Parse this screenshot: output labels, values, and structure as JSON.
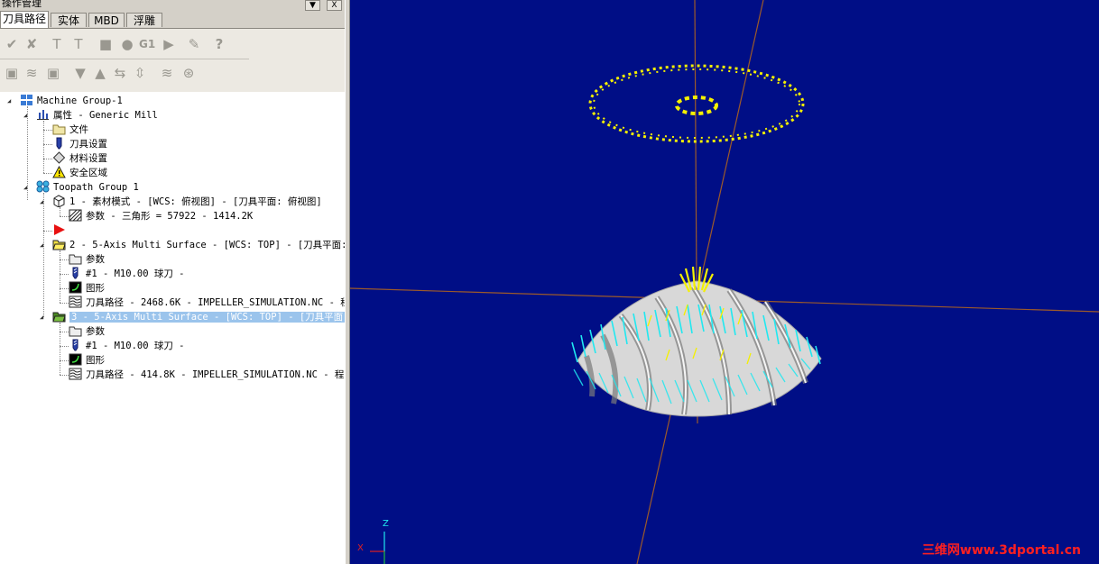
{
  "panel": {
    "title": "操作管理",
    "title_buttons": [
      "▼",
      "X"
    ]
  },
  "tabs": [
    {
      "label": "刀具路径",
      "active": true
    },
    {
      "label": "实体",
      "active": false
    },
    {
      "label": "MBD",
      "active": false
    },
    {
      "label": "浮雕",
      "active": false
    }
  ],
  "toolbar": {
    "row1_icons": [
      "select-all-icon",
      "select-invalid-icon",
      "regenerate-all-icon",
      "regenerate-dirty-icon",
      "stop-icon",
      "verify-icon",
      "simulate-backplot-icon",
      "post-icon",
      "high-feed-icon",
      "help-icon"
    ],
    "row1_g1_label": "G1",
    "row1_question_label": "?",
    "row2_icons": [
      "lock-icon",
      "toggle-display-icon",
      "lock-post-icon",
      "move-down-icon",
      "move-up-icon",
      "insert-arrow-icon",
      "scroll-icon",
      "single-display-icon",
      "toggle-display-group-icon"
    ]
  },
  "tree": [
    {
      "icon": "machine-group-icon",
      "label": "Machine Group-1",
      "expanded": true
    },
    {
      "icon": "properties-icon",
      "label": "属性 - Generic Mill",
      "expanded": true
    },
    {
      "icon": "folder-icon",
      "label": "文件"
    },
    {
      "icon": "tool-settings-icon",
      "label": "刀具设置"
    },
    {
      "icon": "material-settings-icon",
      "label": "材料设置"
    },
    {
      "icon": "warning-icon",
      "label": "安全区域"
    },
    {
      "icon": "toolpath-group-icon",
      "label": "Toopath Group 1",
      "expanded": true
    },
    {
      "icon": "stock-model-icon",
      "label": "1 - 素材模式 - [WCS: 俯视图] - [刀具平面: 俯视图]",
      "expanded": true
    },
    {
      "icon": "params-hatch-icon",
      "label": "参数 - 三角形 =  57922 - 1414.2K"
    },
    {
      "icon": "insert-arrow-flag-icon",
      "label": ""
    },
    {
      "icon": "operation-folder-icon",
      "label": "2 - 5-Axis Multi Surface - [WCS: TOP] - [刀具平面:",
      "expanded": true
    },
    {
      "icon": "params-folder-icon",
      "label": "参数"
    },
    {
      "icon": "ball-tool-icon",
      "label": "#1 - M10.00 球刀 -"
    },
    {
      "icon": "geometry-icon",
      "label": "图形"
    },
    {
      "icon": "toolpath-wave-icon",
      "label": "刀具路径 - 2468.6K - IMPELLER_SIMULATION.NC - 程"
    },
    {
      "icon": "operation-folder-selected-icon",
      "label": "3 - 5-Axis Multi Surface - [WCS: TOP] - [刀具平面",
      "expanded": true,
      "selected": true
    },
    {
      "icon": "params-folder-icon",
      "label": "参数"
    },
    {
      "icon": "ball-tool-icon",
      "label": "#1 - M10.00 球刀 -"
    },
    {
      "icon": "geometry-icon",
      "label": "图形"
    },
    {
      "icon": "toolpath-wave-icon",
      "label": "刀具路径 - 414.8K - IMPELLER_SIMULATION.NC - 程"
    }
  ],
  "viewport": {
    "background": "#000e86",
    "axis_labels": {
      "z": "Z",
      "x": "X"
    },
    "watermark": "三维网www.3dportal.cn",
    "colors": {
      "toolpath_yellow": "#f4f000",
      "toolpath_cyan": "#20e8f0",
      "axis_brown": "#9c5a2a",
      "impeller_grey": "#d8d8d8"
    }
  }
}
